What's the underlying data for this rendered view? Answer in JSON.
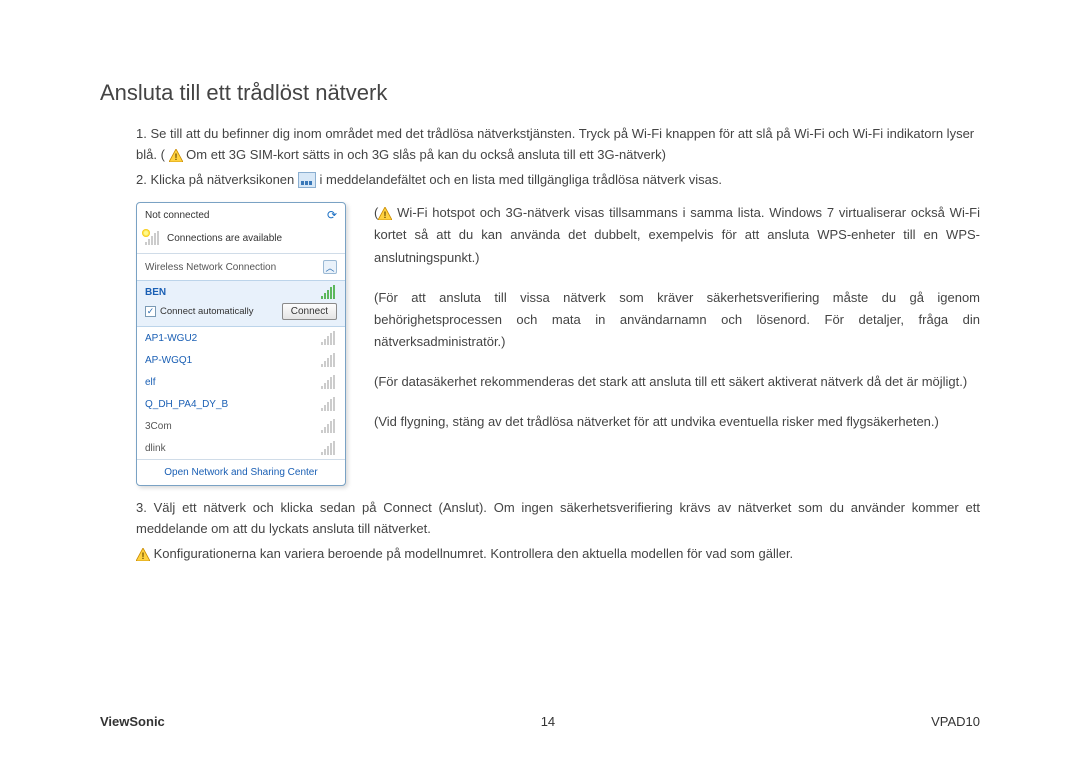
{
  "title": "Ansluta till ett trådlöst nätverk",
  "step1a": "1. Se till att du befinner dig inom området med det trådlösa nätverkstjänsten. Tryck på Wi-Fi knappen för att slå på Wi-Fi och Wi-Fi indikatorn lyser blå. (",
  "step1b": " Om ett 3G SIM-kort sätts in och 3G slås på kan du också ansluta till ett 3G-nätverk)",
  "step2a": "2. Klicka på nätverksikonen ",
  "step2b": " i meddelandefältet och en lista med tillgängliga trådlösa nätverk visas.",
  "side": {
    "p1a": " Wi-Fi hotspot och 3G-nätverk visas tillsammans i samma lista. Windows 7 virtualiserar också Wi-Fi kortet så att du kan använda det dubbelt, exempelvis för att ansluta WPS-enheter till en WPS-anslutningspunkt.)",
    "p2": "(För att ansluta till vissa nätverk som kräver säkerhetsverifiering måste du gå igenom behörighetsprocessen och mata in användarnamn och lösenord. För detaljer, fråga din nätverksadministratör.)",
    "p3": "(För datasäkerhet rekommenderas det stark att ansluta till ett säkert aktiverat nätverk då det är möjligt.)",
    "p4": "(Vid flygning, stäng av det trådlösa nätverket för att undvika eventuella risker med flygsäkerheten.)"
  },
  "step3": "3. Välj ett nätverk och klicka sedan på Connect (Anslut). Om ingen säkerhetsverifiering krävs av nätverket som du använder kommer ett meddelande om att du lyckats ansluta till nätverket.",
  "note": " Konfigurationerna kan variera beroende på modellnumret. Kontrollera den aktuella modellen för vad som gäller.",
  "popup": {
    "not_connected": "Not connected",
    "available": "Connections are available",
    "section": "Wireless Network Connection",
    "selected": "BEN",
    "auto": "Connect automatically",
    "connect": "Connect",
    "items": [
      "AP1-WGU2",
      "AP-WGQ1",
      "elf",
      "Q_DH_PA4_DY_B",
      "3Com",
      "dlink"
    ],
    "footer": "Open Network and Sharing Center"
  },
  "footer": {
    "brand": "ViewSonic",
    "page": "14",
    "model": "VPAD10"
  }
}
